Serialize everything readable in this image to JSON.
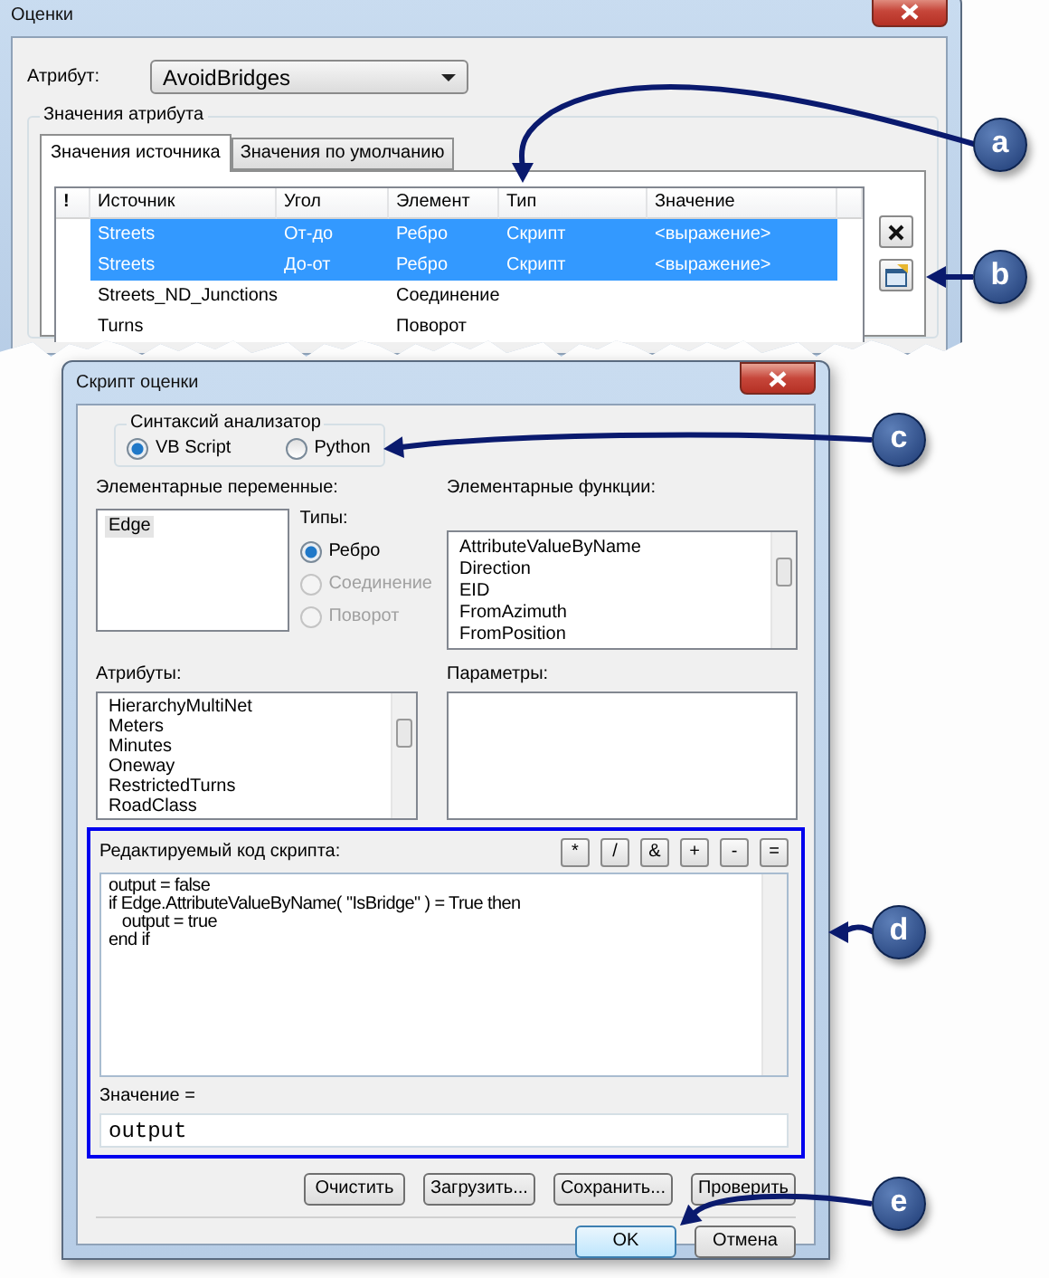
{
  "evaluators_window": {
    "title": "Оценки",
    "attribute_label": "Атрибут:",
    "attribute_value": "AvoidBridges",
    "group_title": "Значения атрибута",
    "tabs": [
      {
        "label": "Значения источника",
        "selected": true
      },
      {
        "label": "Значения по умолчанию",
        "selected": false
      }
    ],
    "table": {
      "columns": [
        "!",
        "Источник",
        "Угол",
        "Элемент",
        "Тип",
        "Значение"
      ],
      "rows": [
        {
          "selected": true,
          "source": "Streets",
          "direction": "От-до",
          "element": "Ребро",
          "type": "Скрипт",
          "value": "<выражение>"
        },
        {
          "selected": true,
          "source": "Streets",
          "direction": "До-от",
          "element": "Ребро",
          "type": "Скрипт",
          "value": "<выражение>"
        },
        {
          "selected": false,
          "source": "Streets_ND_Junctions",
          "element": "Соединение"
        },
        {
          "selected": false,
          "source": "Turns",
          "element": "Поворот"
        }
      ]
    }
  },
  "script_window": {
    "title": "Скрипт оценки",
    "parser_title": "Синтаксий анализатор",
    "parsers": [
      {
        "label": "VB Script",
        "selected": true
      },
      {
        "label": "Python",
        "selected": false
      }
    ],
    "variables_label": "Элементарные переменные:",
    "variables": [
      {
        "label": "Edge",
        "selected": true
      }
    ],
    "types_label": "Типы:",
    "types": [
      {
        "label": "Ребро",
        "selected": true,
        "disabled": false
      },
      {
        "label": "Соединение",
        "selected": false,
        "disabled": true
      },
      {
        "label": "Поворот",
        "selected": false,
        "disabled": true
      }
    ],
    "functions_label": "Элементарные функции:",
    "functions": [
      "AttributeValueByName",
      "Direction",
      "EID",
      "FromAzimuth",
      "FromPosition"
    ],
    "attributes_label": "Атрибуты:",
    "attributes": [
      "HierarchyMultiNet",
      "Meters",
      "Minutes",
      "Oneway",
      "RestrictedTurns",
      "RoadClass"
    ],
    "parameters_label": "Параметры:",
    "code_label": "Редактируемый код скрипта:",
    "operators": [
      "*",
      "/",
      "&",
      "+",
      "-",
      "="
    ],
    "code": [
      "output = false",
      "if Edge.AttributeValueByName( \"IsBridge\" ) = True then",
      "   output = true",
      "end if"
    ],
    "value_label": "Значение =",
    "value": "output",
    "script_buttons": [
      "Очистить",
      "Загрузить...",
      "Сохранить...",
      "Проверить"
    ],
    "ok": "OK",
    "cancel": "Отмена"
  },
  "callouts": [
    "a",
    "b",
    "c",
    "d",
    "e"
  ]
}
